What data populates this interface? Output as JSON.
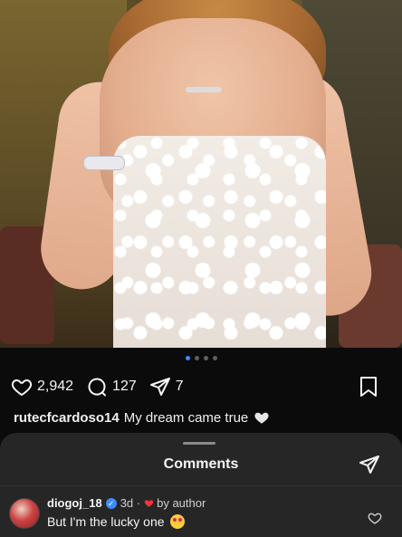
{
  "post": {
    "carousel": {
      "total_dots": 4,
      "active_index": 0
    },
    "actions": {
      "likes": "2,942",
      "comments": "127",
      "shares": "7"
    },
    "caption": {
      "username": "rutecfcardoso14",
      "text": "My dream came true"
    }
  },
  "comments_sheet": {
    "title": "Comments",
    "items": [
      {
        "username": "diogoj_18",
        "time": "3d",
        "by_author": "by author",
        "text": "But I'm the lucky one"
      }
    ]
  },
  "colors": {
    "background": "#0b0b0b",
    "sheet": "#262626",
    "accent_blue": "#3d8bff",
    "heart_red": "#ff3040"
  }
}
